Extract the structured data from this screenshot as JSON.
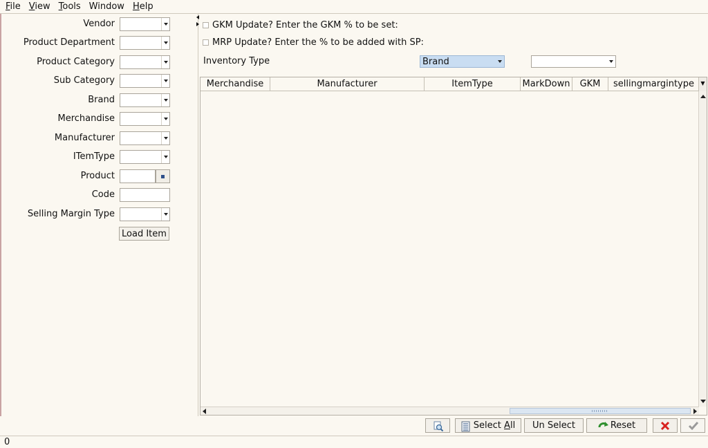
{
  "menu": [
    {
      "pre": "",
      "key": "F",
      "post": "ile"
    },
    {
      "pre": "",
      "key": "V",
      "post": "iew"
    },
    {
      "pre": "",
      "key": "T",
      "post": "ools"
    },
    {
      "pre": "Window",
      "key": "",
      "post": ""
    },
    {
      "pre": "",
      "key": "H",
      "post": "elp"
    }
  ],
  "filters": {
    "vendor": "Vendor",
    "product_department": "Product Department",
    "product_category": "Product Category",
    "sub_category": "Sub Category",
    "brand": "Brand",
    "merchandise": "Merchandise",
    "manufacturer": "Manufacturer",
    "item_type": "ITemType",
    "product": "Product",
    "code": "Code",
    "selling_margin_type": "Selling Margin Type",
    "load_item": "Load Item"
  },
  "options": {
    "gkm_update": "GKM Update? Enter the GKM % to be set:",
    "mrp_update": "MRP Update? Enter the % to be added with SP:",
    "inventory_type_label": "Inventory Type",
    "inventory_type_value": "Brand",
    "second_value": ""
  },
  "table": {
    "columns": [
      "Merchandise",
      "Manufacturer",
      "ItemType",
      "MarkDown",
      "GKM",
      "sellingmargintype"
    ],
    "rows": []
  },
  "toolbar": {
    "select_all_pre": "Select ",
    "select_all_key": "A",
    "select_all_post": "ll",
    "unselect": "Un Select",
    "reset": "Reset"
  },
  "status": {
    "text": "0"
  },
  "colors": {
    "accent_selection": "#c9ddf2",
    "cancel_red": "#d8221f",
    "ok_gray": "#9a9a9a",
    "reset_green": "#2f8f2f"
  }
}
